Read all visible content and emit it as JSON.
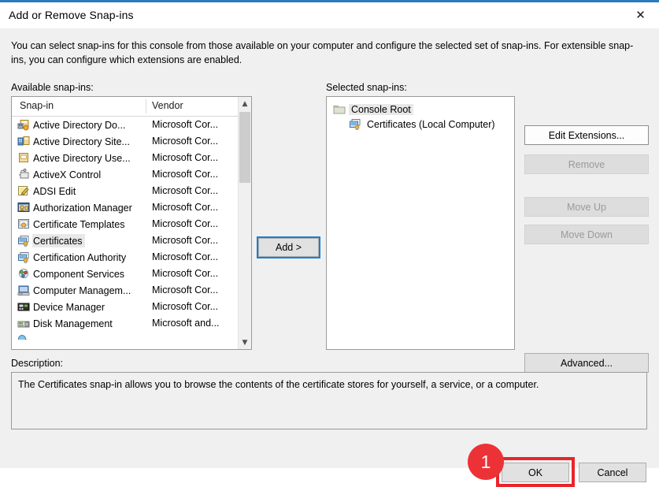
{
  "window": {
    "title": "Add or Remove Snap-ins",
    "close_icon": "close-icon"
  },
  "intro": "You can select snap-ins for this console from those available on your computer and configure the selected set of snap-ins. For extensible snap-ins, you can configure which extensions are enabled.",
  "labels": {
    "available": "Available snap-ins:",
    "selected": "Selected snap-ins:",
    "description": "Description:"
  },
  "available_list": {
    "columns": [
      "Snap-in",
      "Vendor"
    ],
    "rows": [
      {
        "name": "Active Directory Do...",
        "vendor": "Microsoft Cor...",
        "icon": "active-directory-domains-icon",
        "selected": false
      },
      {
        "name": "Active Directory Site...",
        "vendor": "Microsoft Cor...",
        "icon": "active-directory-sites-icon",
        "selected": false
      },
      {
        "name": "Active Directory Use...",
        "vendor": "Microsoft Cor...",
        "icon": "active-directory-users-icon",
        "selected": false
      },
      {
        "name": "ActiveX Control",
        "vendor": "Microsoft Cor...",
        "icon": "activex-control-icon",
        "selected": false
      },
      {
        "name": "ADSI Edit",
        "vendor": "Microsoft Cor...",
        "icon": "adsi-edit-icon",
        "selected": false
      },
      {
        "name": "Authorization Manager",
        "vendor": "Microsoft Cor...",
        "icon": "authorization-manager-icon",
        "selected": false
      },
      {
        "name": "Certificate Templates",
        "vendor": "Microsoft Cor...",
        "icon": "certificate-templates-icon",
        "selected": false
      },
      {
        "name": "Certificates",
        "vendor": "Microsoft Cor...",
        "icon": "certificates-icon",
        "selected": true
      },
      {
        "name": "Certification Authority",
        "vendor": "Microsoft Cor...",
        "icon": "certification-authority-icon",
        "selected": false
      },
      {
        "name": "Component Services",
        "vendor": "Microsoft Cor...",
        "icon": "component-services-icon",
        "selected": false
      },
      {
        "name": "Computer Managem...",
        "vendor": "Microsoft Cor...",
        "icon": "computer-management-icon",
        "selected": false
      },
      {
        "name": "Device Manager",
        "vendor": "Microsoft Cor...",
        "icon": "device-manager-icon",
        "selected": false
      },
      {
        "name": "Disk Management",
        "vendor": "Microsoft and...",
        "icon": "disk-management-icon",
        "selected": false
      }
    ],
    "scrollbar": {
      "up_arrow": "chevron-up-icon",
      "down_arrow": "chevron-down-icon"
    }
  },
  "add_button": {
    "label": "Add >",
    "focused": true
  },
  "selected_tree": {
    "root": {
      "label": "Console Root",
      "icon": "folder-icon"
    },
    "children": [
      {
        "label": "Certificates (Local Computer)",
        "icon": "certificates-icon"
      }
    ]
  },
  "side_buttons": [
    {
      "label": "Edit Extensions...",
      "name": "edit-extensions-button",
      "enabled": true
    },
    {
      "label": "Remove",
      "name": "remove-button",
      "enabled": false
    },
    {
      "label": "Move Up",
      "name": "move-up-button",
      "enabled": false
    },
    {
      "label": "Move Down",
      "name": "move-down-button",
      "enabled": false
    },
    {
      "label": "Advanced...",
      "name": "advanced-button",
      "enabled": true
    }
  ],
  "description": "The Certificates snap-in allows you to browse the contents of the certificate stores for yourself, a service, or a computer.",
  "footer": {
    "ok": "OK",
    "cancel": "Cancel"
  },
  "annotation": {
    "badge_number": "1",
    "color": "#ec3237",
    "target": "ok-button"
  },
  "colors": {
    "dialog_bg": "#f0f0f0",
    "accent_line": "#2a7ac0",
    "focus_ring": "#1a7fd4",
    "selection": "#e8e8e8"
  }
}
